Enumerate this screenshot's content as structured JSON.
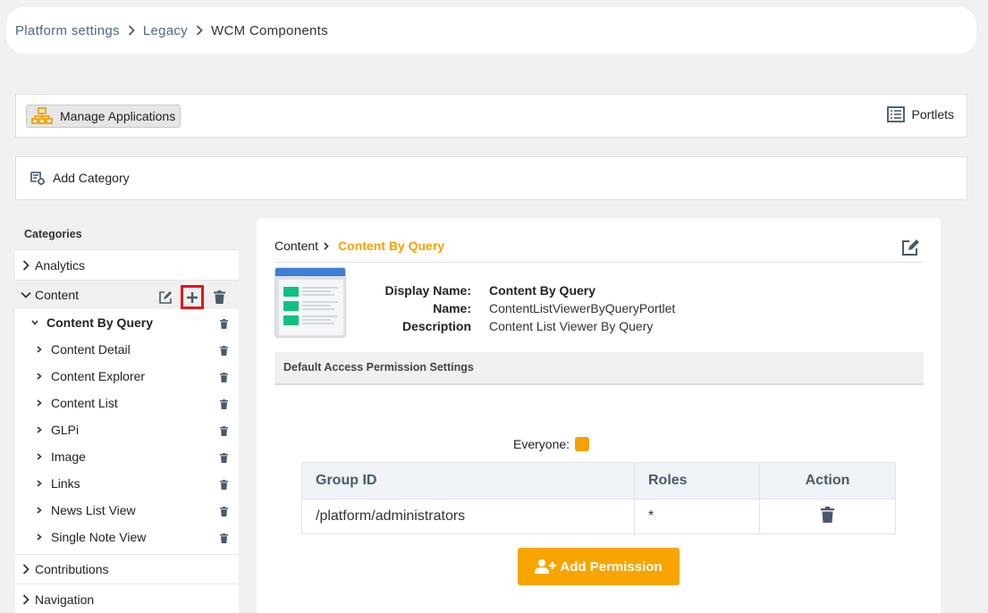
{
  "breadcrumb": {
    "items": [
      "Platform settings",
      "Legacy"
    ],
    "current": "WCM Components"
  },
  "toolbar": {
    "manage_label": "Manage Applications",
    "portlets_label": "Portlets"
  },
  "add_category_label": "Add Category",
  "sidebar": {
    "heading": "Categories",
    "categories_before": [
      {
        "label": "Analytics"
      }
    ],
    "open_category": {
      "label": "Content",
      "portlets": [
        {
          "label": "Content By Query",
          "active": true
        },
        {
          "label": "Content Detail"
        },
        {
          "label": "Content Explorer"
        },
        {
          "label": "Content List"
        },
        {
          "label": "GLPi"
        },
        {
          "label": "Image"
        },
        {
          "label": "Links"
        },
        {
          "label": "News List View"
        },
        {
          "label": "Single Note View"
        }
      ]
    },
    "categories_after": [
      {
        "label": "Contributions"
      },
      {
        "label": "Navigation"
      }
    ]
  },
  "main": {
    "breadcrumb_parent": "Content",
    "breadcrumb_current": "Content By Query",
    "display_name_label": "Display Name:",
    "display_name": "Content By Query",
    "name_label": "Name:",
    "name": "ContentListViewerByQueryPortlet",
    "description_label": "Description",
    "description": "Content List Viewer By Query",
    "permission_heading": "Default Access Permission Settings",
    "everyone_label": "Everyone:",
    "table": {
      "headers": [
        "Group ID",
        "Roles",
        "Action"
      ],
      "rows": [
        {
          "group": "/platform/administrators",
          "roles": "*"
        }
      ]
    },
    "add_permission_label": "Add Permission"
  },
  "colors": {
    "accent": "#f4a100",
    "highlight": "#e8151d",
    "thumb_bar": "#3d7fd6",
    "thumb_item": "#12c07f"
  }
}
